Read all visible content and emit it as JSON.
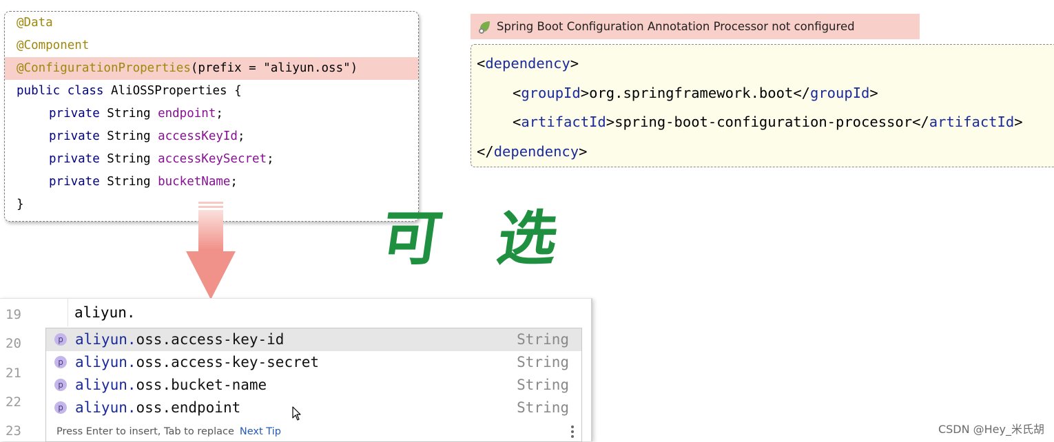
{
  "java": {
    "lines": [
      {
        "annotation": "@Data"
      },
      {
        "annotation": "@Component"
      },
      {
        "annotation": "@ConfigurationProperties",
        "rest": "(prefix = \"aliyun.oss\")"
      },
      {
        "kw": "public class",
        "name": " AliOSSProperties {"
      },
      {
        "kw": "private",
        "type": " String ",
        "field": "endpoint",
        "end": ";"
      },
      {
        "kw": "private",
        "type": " String ",
        "field": "accessKeyId",
        "end": ";"
      },
      {
        "kw": "private",
        "type": " String ",
        "field": "accessKeySecret",
        "end": ";"
      },
      {
        "kw": "private",
        "type": " String ",
        "field": "bucketName",
        "end": ";"
      },
      {
        "brace": "}"
      }
    ]
  },
  "warning": {
    "text": "Spring Boot Configuration Annotation Processor not configured",
    "icon": "spring-leaf-icon"
  },
  "xml": {
    "open_dep": "dependency",
    "group_tag": "groupId",
    "group_val": "org.springframework.boot",
    "artifact_tag": "artifactId",
    "artifact_val": "spring-boot-configuration-processor",
    "close_dep": "dependency"
  },
  "optional_label": "可 选",
  "editor": {
    "line_numbers": [
      "19",
      "20",
      "21",
      "22",
      "23"
    ],
    "typed": "aliyun.",
    "items": [
      {
        "prefix": "aliyun.",
        "rest": "oss.access-key-id",
        "type": "String",
        "badge": "p"
      },
      {
        "prefix": "aliyun.",
        "rest": "oss.access-key-secret",
        "type": "String",
        "badge": "p"
      },
      {
        "prefix": "aliyun.",
        "rest": "oss.bucket-name",
        "type": "String",
        "badge": "p"
      },
      {
        "prefix": "aliyun.",
        "rest": "oss.endpoint",
        "type": "String",
        "badge": "p"
      }
    ],
    "hint": "Press Enter to insert, Tab to replace",
    "next_tip": "Next Tip"
  },
  "watermark": "CSDN @Hey_米氏胡",
  "colors": {
    "highlight": "#f8cfc9",
    "xml_bg": "#fdfde9",
    "green": "#1e9040",
    "selected": "#e6e6e6"
  }
}
